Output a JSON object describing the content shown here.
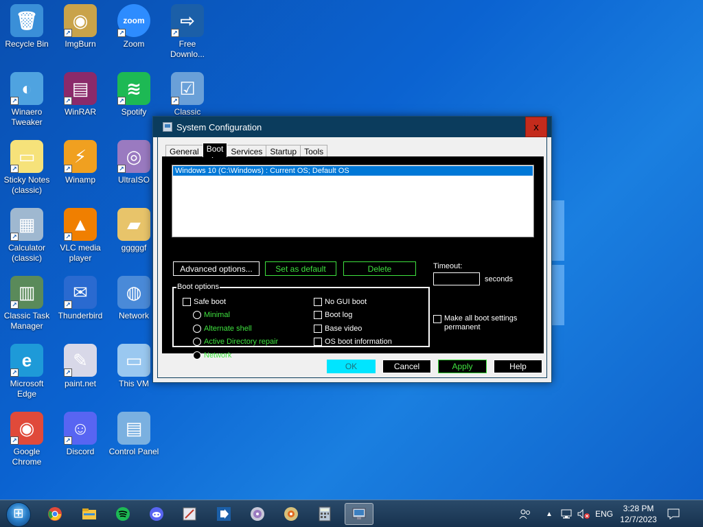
{
  "desktop": {
    "icons": [
      {
        "label": "Recycle Bin",
        "glyph": "🗑",
        "bg": "#3a8fd8",
        "shortcut": false
      },
      {
        "label": "ImgBurn",
        "glyph": "◉",
        "bg": "#c9a34a",
        "shortcut": true
      },
      {
        "label": "Zoom",
        "glyph": "zoom",
        "bg": "#2d8cff",
        "shortcut": true
      },
      {
        "label": "Free Downlo...",
        "glyph": "⇨",
        "bg": "#1b5fa8",
        "shortcut": true
      },
      {
        "label": "Winaero Tweaker",
        "glyph": "◐",
        "bg": "#4fa3e0",
        "shortcut": true
      },
      {
        "label": "WinRAR",
        "glyph": "▤",
        "bg": "#8b2a6a",
        "shortcut": true
      },
      {
        "label": "Spotify",
        "glyph": "≋",
        "bg": "#1db954",
        "shortcut": true
      },
      {
        "label": "Classic",
        "glyph": "☑",
        "bg": "#6aa0d8",
        "shortcut": true
      },
      {
        "label": "Sticky Notes (classic)",
        "glyph": "▭",
        "bg": "#f6e27a",
        "shortcut": true
      },
      {
        "label": "Winamp",
        "glyph": "⚡",
        "bg": "#f0a020",
        "shortcut": true
      },
      {
        "label": "UltraISO",
        "glyph": "◎",
        "bg": "#9a7ac0",
        "shortcut": true
      },
      {
        "label": "Calculator (classic)",
        "glyph": "▦",
        "bg": "#9fb8d0",
        "shortcut": true
      },
      {
        "label": "VLC media player",
        "glyph": "▲",
        "bg": "#f07f00",
        "shortcut": true
      },
      {
        "label": "gggggf",
        "glyph": "▰",
        "bg": "#e8c46a",
        "shortcut": false
      },
      {
        "label": "Classic Task Manager",
        "glyph": "▥",
        "bg": "#5a8a5a",
        "shortcut": true
      },
      {
        "label": "Thunderbird",
        "glyph": "✉",
        "bg": "#2a6ad0",
        "shortcut": true
      },
      {
        "label": "Network",
        "glyph": "◍",
        "bg": "#4a8ad8",
        "shortcut": false
      },
      {
        "label": "Microsoft Edge",
        "glyph": "e",
        "bg": "#1e9ad8",
        "shortcut": true
      },
      {
        "label": "paint.net",
        "glyph": "✎",
        "bg": "#d8d8e8",
        "shortcut": true
      },
      {
        "label": "This VM",
        "glyph": "▭",
        "bg": "#9ac8f0",
        "shortcut": false
      },
      {
        "label": "Google Chrome",
        "glyph": "◉",
        "bg": "#e04a3a",
        "shortcut": true
      },
      {
        "label": "Discord",
        "glyph": "☺",
        "bg": "#5865f2",
        "shortcut": true
      },
      {
        "label": "Control Panel",
        "glyph": "▤",
        "bg": "#7ab0e0",
        "shortcut": false
      }
    ]
  },
  "dialog": {
    "title": "System Configuration",
    "close_label": "x",
    "tabs": [
      "General",
      "Boot",
      "Services",
      "Startup",
      "Tools"
    ],
    "active_tab": "Boot",
    "os_entries": [
      "Windows 10 (C:\\Windows) : Current OS; Default OS"
    ],
    "buttons": {
      "advanced": "Advanced options...",
      "set_default": "Set as default",
      "delete": "Delete"
    },
    "boot_options": {
      "legend": "Boot options",
      "safe_boot": "Safe boot",
      "minimal": "Minimal",
      "alternate_shell": "Alternate shell",
      "ad_repair": "Active Directory repair",
      "network": "Network",
      "no_gui_boot": "No GUI boot",
      "boot_log": "Boot log",
      "base_video": "Base video",
      "os_boot_info": "OS boot information"
    },
    "timeout": {
      "label": "Timeout:",
      "value": "",
      "unit": "seconds"
    },
    "make_permanent": "Make all boot settings permanent",
    "footer": {
      "ok": "OK",
      "cancel": "Cancel",
      "apply": "Apply",
      "help": "Help"
    }
  },
  "taskbar": {
    "apps": [
      "chrome-icon",
      "file-explorer-icon",
      "spotify-icon",
      "discord-icon",
      "paint-net-icon",
      "free-download-icon",
      "ultraiso-icon",
      "imgburn-icon",
      "calculator-icon",
      "system-configuration-icon"
    ],
    "language": "ENG",
    "time": "3:28 PM",
    "date": "12/7/2023"
  }
}
